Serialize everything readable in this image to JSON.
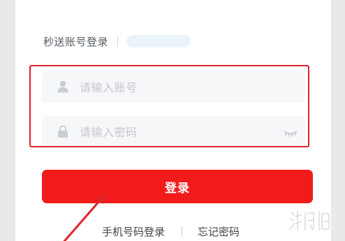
{
  "login_tabs": {
    "active_tab_label": "秒送账号登录"
  },
  "account_field": {
    "placeholder": "请输入账号",
    "icon": "user-icon"
  },
  "password_field": {
    "placeholder": "请输入密码",
    "icon": "lock-icon",
    "toggle_icon": "eye-closed-icon"
  },
  "login_button": {
    "label": "登录"
  },
  "footer_links": {
    "phone_login": "手机号码登录",
    "forgot_password": "忘记密码"
  },
  "annotations": {
    "highlight_color": "#e0242a",
    "arrow_color": "#e0242a"
  },
  "colors": {
    "accent": "#f21b1b",
    "field_bg": "#f6f7f9",
    "placeholder": "#c4c7cc"
  }
}
